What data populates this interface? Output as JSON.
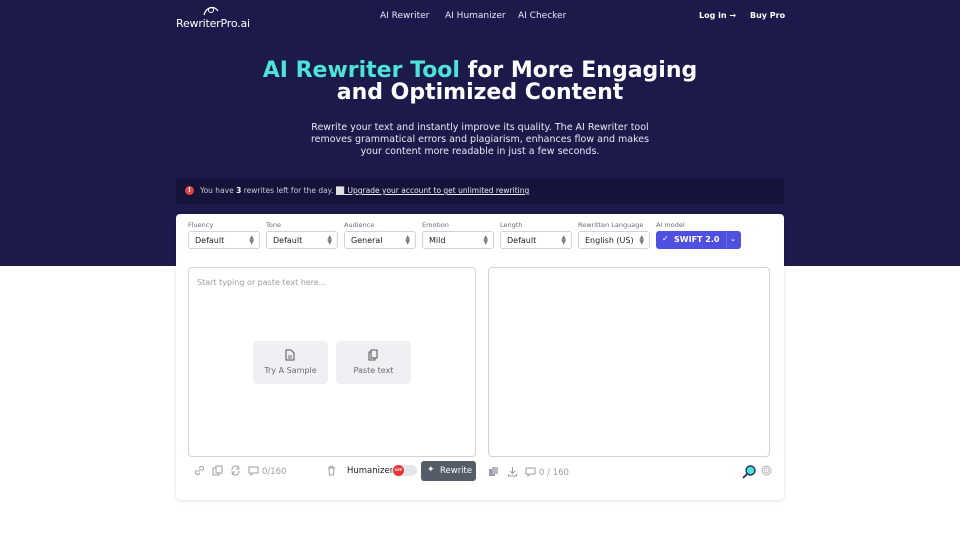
{
  "nav": {
    "logo_text": "RewriterPro.ai",
    "links": [
      "AI Rewriter",
      "AI Humanizer",
      "AI Checker"
    ],
    "login": "Log in →",
    "buy_pro": "Buy Pro"
  },
  "hero": {
    "title_accent": "AI Rewriter Tool",
    "title_rest": "for More Engaging",
    "title_line2": "and Optimized Content",
    "subtitle": "Rewrite your text and instantly improve its quality. The AI Rewriter tool removes grammatical errors and plagiarism, enhances flow and makes your content more readable in just a few seconds."
  },
  "notice": {
    "icon": "!",
    "prefix": "You have ",
    "count": "3",
    "suffix": " rewrites left for the day.",
    "link": "⬜ Upgrade your account to get unlimited rewriting"
  },
  "options": [
    {
      "label": "Fluency",
      "value": "Default"
    },
    {
      "label": "Tone",
      "value": "Default"
    },
    {
      "label": "Audience",
      "value": "General"
    },
    {
      "label": "Emotion",
      "value": "Mild"
    },
    {
      "label": "Length",
      "value": "Default"
    },
    {
      "label": "Rewritten Language",
      "value": "English (US)"
    }
  ],
  "model": {
    "label": "AI model",
    "value": "SWIFT 2.0"
  },
  "input": {
    "placeholder": "Start typing or paste text here...",
    "try_sample": "Try A Sample",
    "paste_text": "Paste text",
    "count": "0/160"
  },
  "humanizer": {
    "label": "Humanizer:",
    "state": "OFF"
  },
  "rewrite_button": "Rewrite",
  "output": {
    "count": "0 / 160"
  },
  "colors": {
    "hero_bg": "#1c1a4a",
    "accent": "#4ee3d8",
    "primary": "#4f4fe0",
    "rewrite_btn": "#545c68"
  }
}
